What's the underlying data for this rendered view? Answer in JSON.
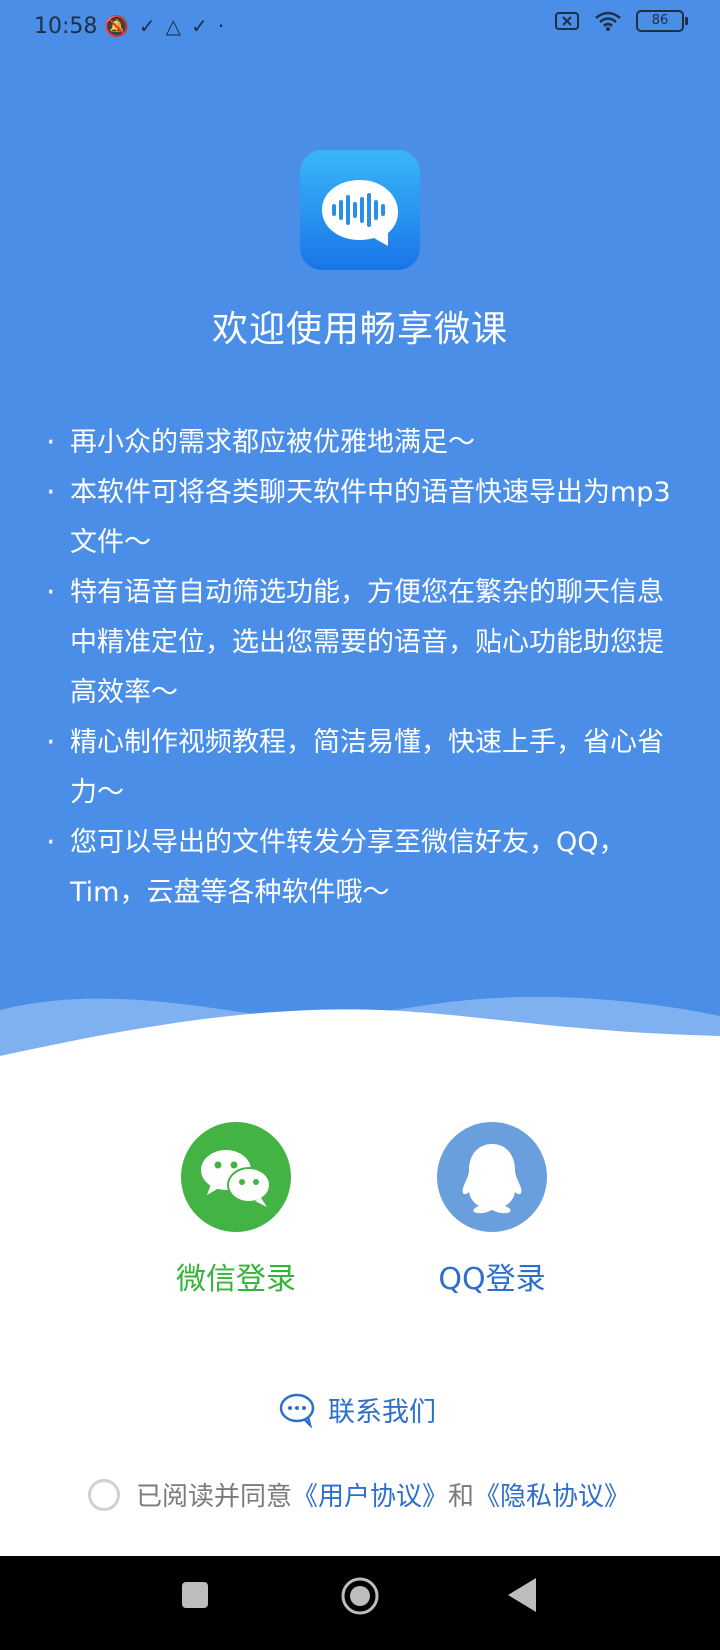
{
  "status_bar": {
    "time": "10:58",
    "battery": "86"
  },
  "app": {
    "title": "欢迎使用畅享微课"
  },
  "features": [
    "再小众的需求都应被优雅地满足～",
    "本软件可将各类聊天软件中的语音快速导出为mp3文件～",
    "特有语音自动筛选功能，方便您在繁杂的聊天信息中精准定位，选出您需要的语音，贴心功能助您提高效率～",
    "精心制作视频教程，简洁易懂，快速上手，省心省力～",
    "您可以导出的文件转发分享至微信好友，QQ，Tim，云盘等各种软件哦～"
  ],
  "login": {
    "wechat_label": "微信登录",
    "qq_label": "QQ登录"
  },
  "contact": {
    "label": "联系我们"
  },
  "agreement": {
    "prefix": "已阅读并同意",
    "user_agreement": "《用户协议》",
    "conjunction": "和",
    "privacy_agreement": "《隐私协议》"
  },
  "colors": {
    "header_blue": "#4a8ee8",
    "wechat_green": "#43b344",
    "qq_blue": "#6a9fde",
    "link_blue": "#2f6fcc"
  },
  "icons": {
    "logo": "voice-wave-bubble-icon",
    "wechat": "wechat-icon",
    "qq": "qq-penguin-icon",
    "contact": "chat-bubble-icon"
  }
}
